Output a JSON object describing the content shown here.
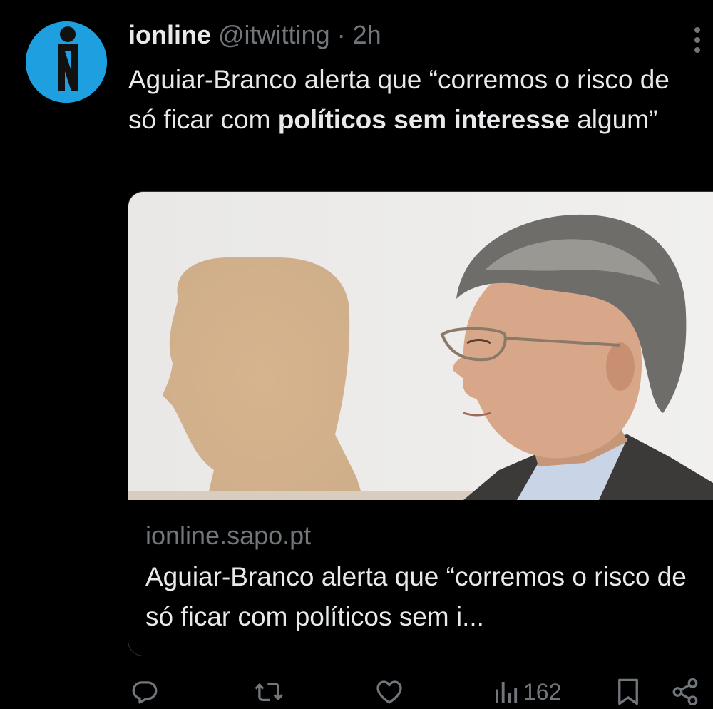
{
  "tweet": {
    "author": {
      "name": "ionline",
      "handle": "@itwitting",
      "separator": "·",
      "time": "2h"
    },
    "text": {
      "part1": "Aguiar-Branco alerta que “corremos o risco de só ficar com ",
      "bold1": "políticos sem interesse",
      "part2": " algum”"
    },
    "card": {
      "domain": "ionline.sapo.pt",
      "title": "Aguiar-Branco alerta que “corremos o risco de só ficar com políticos sem i..."
    },
    "actions": {
      "views": "162"
    }
  },
  "icons": {
    "avatar": "ionline-logo",
    "more": "more-vertical-icon",
    "reply": "reply-icon",
    "retweet": "retweet-icon",
    "like": "heart-icon",
    "views": "views-bar-chart-icon",
    "bookmark": "bookmark-icon",
    "share": "share-icon"
  },
  "colors": {
    "background": "#000000",
    "text": "#e7e9ea",
    "muted": "#71767b",
    "border": "#2f3336",
    "avatar_bg": "#1d9fe0"
  }
}
